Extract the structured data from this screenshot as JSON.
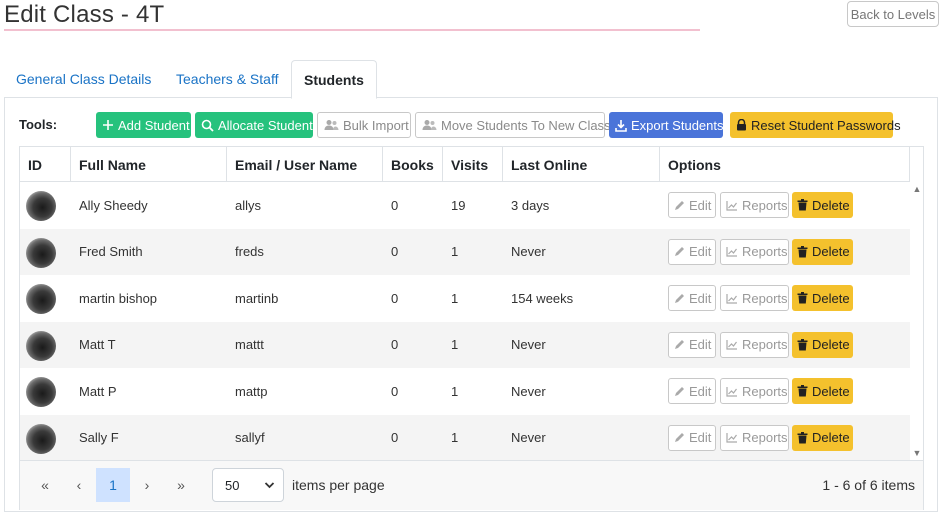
{
  "page": {
    "title": "Edit Class - 4T",
    "back_label": "Back to Levels"
  },
  "tabs": [
    {
      "label": "General Class Details"
    },
    {
      "label": "Teachers & Staff"
    },
    {
      "label": "Students"
    }
  ],
  "toolbar": {
    "tools_label": "Tools:",
    "add_student": "Add Student",
    "allocate_student": "Allocate Student",
    "bulk_import": "Bulk Import",
    "move_students": "Move Students To New Class",
    "export_students": "Export Students",
    "reset_passwords": "Reset Student Passwords"
  },
  "table": {
    "headers": [
      "ID",
      "Full Name",
      "Email / User Name",
      "Books",
      "Visits",
      "Last Online",
      "Options"
    ],
    "rows": [
      {
        "name": "Ally Sheedy",
        "username": "allys",
        "books": "0",
        "visits": "19",
        "last_online": "3 days"
      },
      {
        "name": "Fred Smith",
        "username": "freds",
        "books": "0",
        "visits": "1",
        "last_online": "Never"
      },
      {
        "name": "martin bishop",
        "username": "martinb",
        "books": "0",
        "visits": "1",
        "last_online": "154 weeks"
      },
      {
        "name": "Matt T",
        "username": "mattt",
        "books": "0",
        "visits": "1",
        "last_online": "Never"
      },
      {
        "name": "Matt P",
        "username": "mattp",
        "books": "0",
        "visits": "1",
        "last_online": "Never"
      },
      {
        "name": "Sally F",
        "username": "sallyf",
        "books": "0",
        "visits": "1",
        "last_online": "Never"
      }
    ],
    "options": {
      "edit": "Edit",
      "reports": "Reports",
      "delete": "Delete"
    }
  },
  "pager": {
    "current_page": "1",
    "page_size": "50",
    "items_per_page_label": "items per page",
    "count_label": "1 - 6 of 6 items"
  },
  "colors": {
    "green": "#26c27d",
    "blue": "#4a74d9",
    "yellow": "#f4c12d",
    "link": "#1a73c6"
  }
}
